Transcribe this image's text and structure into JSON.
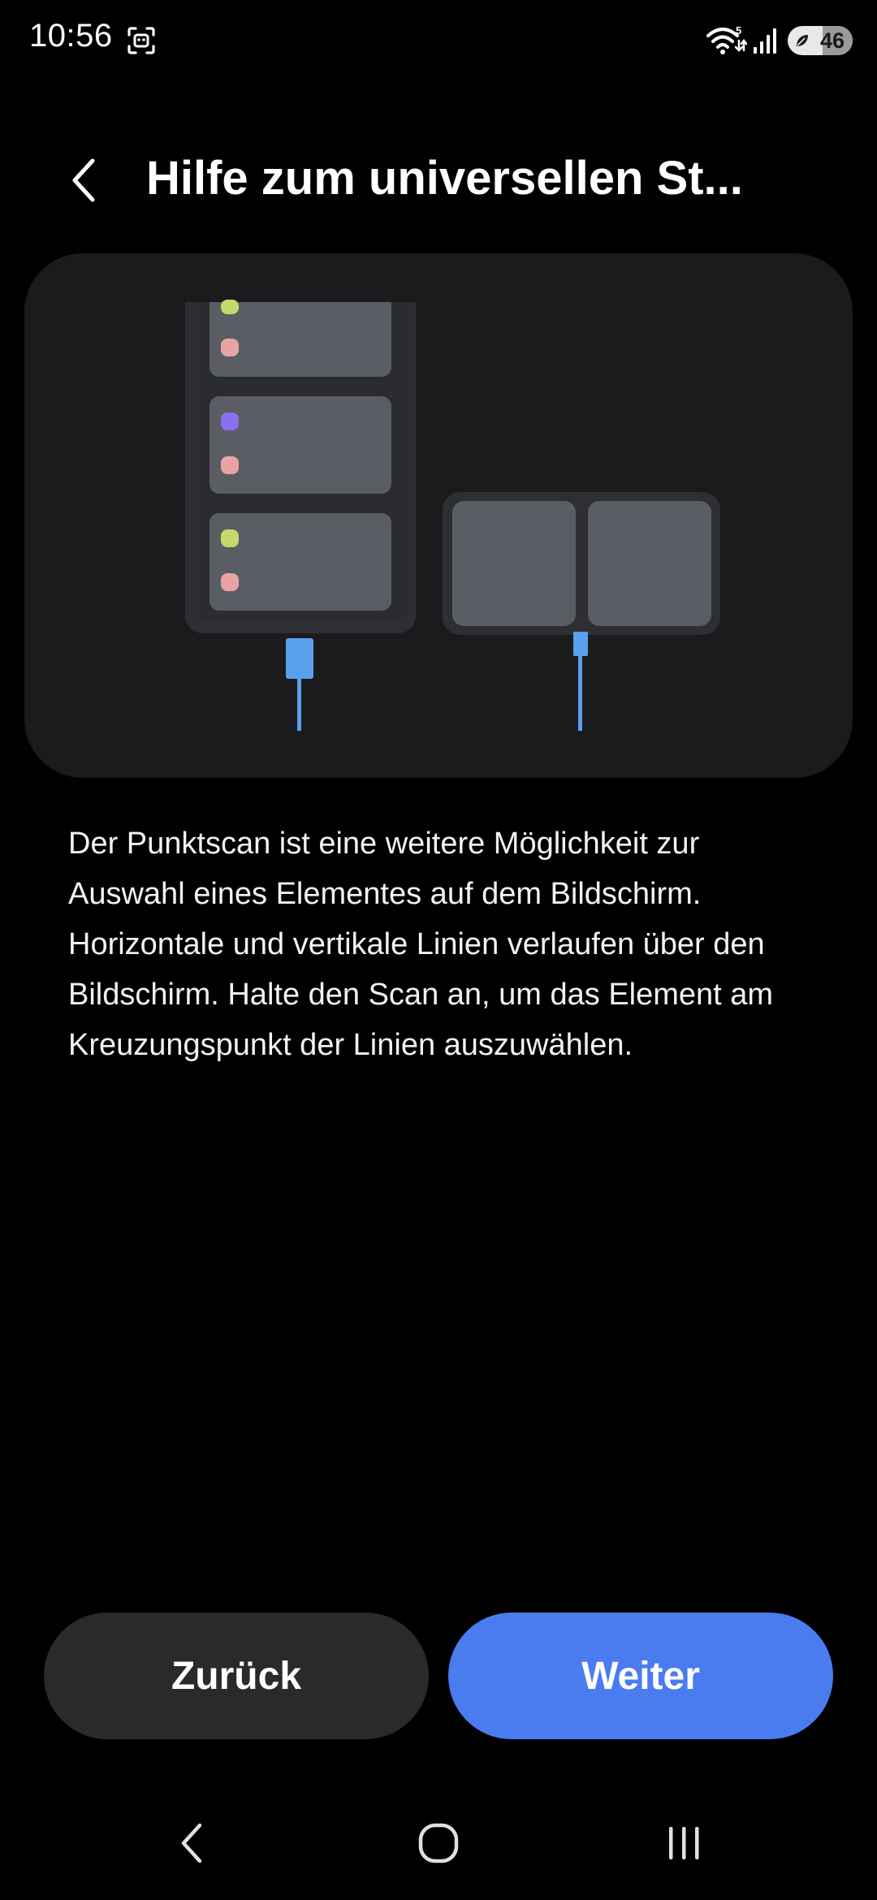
{
  "status_bar": {
    "time": "10:56",
    "network_superscript": "5",
    "battery_level": "46",
    "icons": [
      "screenshot-icon",
      "wifi-icon",
      "signal-icon",
      "battery-saver-leaf-icon"
    ]
  },
  "header": {
    "back_icon": "chevron-left-icon",
    "title": "Hilfe zum universellen St..."
  },
  "illustration": {
    "description_icons": [
      "phone-icon",
      "tablet-icon",
      "cable-icon"
    ],
    "colors": {
      "card_background": "#1b1b1d",
      "device_frame": "#2e2f33",
      "tile": "#5a5d63",
      "dot_green": "#c4d86a",
      "dot_pink": "#e8a4a4",
      "dot_purple": "#8b6ff0",
      "cable": "#5aa0ec"
    }
  },
  "description": {
    "text": "Der Punktscan ist eine weitere Möglichkeit zur Auswahl eines Elementes auf dem Bildschirm. Horizontale und vertikale Linien verlaufen über den Bildschirm. Halte den Scan an, um das Element am Kreuzungspunkt der Linien auszuwählen."
  },
  "buttons": {
    "back_label": "Zurück",
    "next_label": "Weiter",
    "back_color": "#2a2a2c",
    "next_color": "#4a7cf0"
  },
  "nav_bar": {
    "icons": [
      "nav-back-icon",
      "nav-home-icon",
      "nav-recents-icon"
    ]
  }
}
